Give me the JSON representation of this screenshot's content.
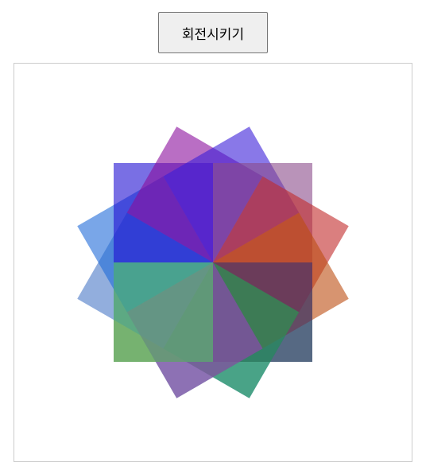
{
  "toolbar": {
    "rotate_label": "회전시키기"
  },
  "canvas": {
    "squares": [
      {
        "angle": 0,
        "color": "#2aa248"
      },
      {
        "angle": 30,
        "color": "#1e69d6"
      },
      {
        "angle": 60,
        "color": "#0b9c7c"
      },
      {
        "angle": 90,
        "color": "#7e5f20"
      },
      {
        "angle": 120,
        "color": "#4a78c6"
      },
      {
        "angle": 150,
        "color": "#1f6ad9"
      },
      {
        "angle": 180,
        "color": "#1f0fd2"
      },
      {
        "angle": 210,
        "color": "#8b0d9c"
      },
      {
        "angle": 240,
        "color": "#3b1ed8"
      },
      {
        "angle": 270,
        "color": "#8a4b8a"
      },
      {
        "angle": 300,
        "color": "#c22a2a"
      },
      {
        "angle": 330,
        "color": "#bd4d10"
      },
      {
        "angle": 360,
        "color": "#3b2a7a"
      },
      {
        "angle": 390,
        "color": "#2aa248"
      },
      {
        "angle": 420,
        "color": "#a33ab8"
      },
      {
        "angle": 450,
        "color": "#4fc06a"
      }
    ],
    "square_opacity": 0.6
  }
}
